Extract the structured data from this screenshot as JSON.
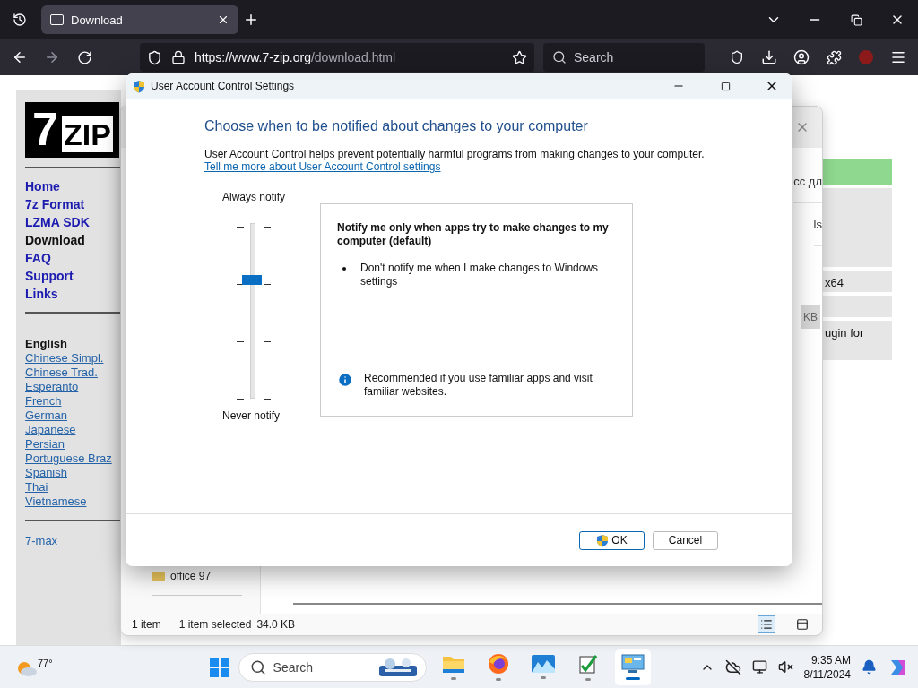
{
  "browser": {
    "tabs": [
      {
        "label": "Download",
        "selected": true
      }
    ],
    "url_host": "https://www.7-zip.org",
    "url_path": "/download.html",
    "search": {
      "placeholder": "Search"
    }
  },
  "page": {
    "logo": {
      "digit": "7",
      "word": "ZIP"
    },
    "nav": [
      {
        "label": "Home",
        "selected": false
      },
      {
        "label": "7z Format",
        "selected": false
      },
      {
        "label": "LZMA SDK",
        "selected": false
      },
      {
        "label": "Download",
        "selected": true
      },
      {
        "label": "FAQ",
        "selected": false
      },
      {
        "label": "Support",
        "selected": false
      },
      {
        "label": "Links",
        "selected": false
      }
    ],
    "languages": [
      {
        "label": "English",
        "selected": true
      },
      {
        "label": "Chinese Simpl.",
        "selected": false
      },
      {
        "label": "Chinese Trad.",
        "selected": false
      },
      {
        "label": "Esperanto",
        "selected": false
      },
      {
        "label": "French",
        "selected": false
      },
      {
        "label": "German",
        "selected": false
      },
      {
        "label": "Japanese",
        "selected": false
      },
      {
        "label": "Persian",
        "selected": false
      },
      {
        "label": "Portuguese Braz",
        "selected": false
      },
      {
        "label": "Spanish",
        "selected": false
      },
      {
        "label": "Thai",
        "selected": false
      },
      {
        "label": "Vietnamese",
        "selected": false
      }
    ],
    "extra_link": "7-max",
    "rows": [
      {
        "text": "",
        "highlighted": true
      },
      {
        "text": "",
        "highlighted": false
      },
      {
        "text": "x64",
        "highlighted": false
      },
      {
        "text": "",
        "highlighted": false
      },
      {
        "text": "ugin for",
        "highlighted": false
      }
    ]
  },
  "explorer": {
    "fragments": [
      "сс дл",
      "ls"
    ],
    "size_chip": "KB",
    "folder": "office 97",
    "status": [
      "1 item",
      "1 item selected",
      "34.0 KB"
    ],
    "views": [
      {
        "kind": "details",
        "selected": true
      },
      {
        "kind": "tiles",
        "selected": false
      }
    ]
  },
  "dialog": {
    "title": "User Account Control Settings",
    "heading": "Choose when to be notified about changes to your computer",
    "description": "User Account Control helps prevent potentially harmful programs from making changes to your computer.",
    "link": "Tell me more about User Account Control settings",
    "slider": {
      "top_label": "Always notify",
      "bottom_label": "Never notify",
      "level": 0.67
    },
    "info": {
      "title": "Notify me only when apps try to make changes to my computer (default)",
      "bullets": [
        "Don't notify me when I make changes to Windows settings"
      ],
      "recommendation": "Recommended if you use familiar apps and visit familiar websites."
    },
    "buttons": [
      {
        "label": "OK",
        "default": true
      },
      {
        "label": "Cancel",
        "default": false
      }
    ]
  },
  "taskbar": {
    "weather": "77°",
    "search": {
      "placeholder": "Search"
    },
    "apps": [
      {
        "kind": "folder",
        "selected": false
      },
      {
        "kind": "browser",
        "selected": false
      },
      {
        "kind": "photos",
        "selected": false
      },
      {
        "kind": "notes",
        "selected": false
      },
      {
        "kind": "control",
        "selected": true
      }
    ],
    "time": "9:35 AM",
    "date": "8/11/2024"
  }
}
